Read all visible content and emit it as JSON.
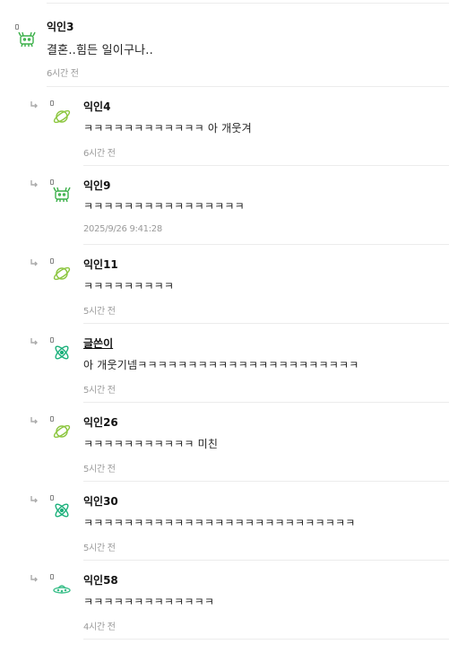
{
  "comments": [
    {
      "nickname": "익인3",
      "text": "결혼..힘든 일이구나..",
      "time": "6시간 전",
      "avatar_icon": "crab-icon",
      "is_reply": false
    },
    {
      "nickname": "익인4",
      "text": "ㅋㅋㅋㅋㅋㅋㅋㅋㅋㅋㅋㅋ 아 개웃겨",
      "time": "6시간 전",
      "avatar_icon": "planet-icon",
      "is_reply": true
    },
    {
      "nickname": "익인9",
      "text": "ㅋㅋㅋㅋㅋㅋㅋㅋㅋㅋㅋㅋㅋㅋㅋㅋ",
      "time": "2025/9/26 9:41:28",
      "avatar_icon": "crab-icon",
      "is_reply": true
    },
    {
      "nickname": "익인11",
      "text": "ㅋㅋㅋㅋㅋㅋㅋㅋㅋ",
      "time": "5시간 전",
      "avatar_icon": "planet-icon",
      "is_reply": true
    },
    {
      "nickname": "글쓴이",
      "text": "아 개웃기넴ㅋㅋㅋㅋㅋㅋㅋㅋㅋㅋㅋㅋㅋㅋㅋㅋㅋㅋㅋㅋㅋㅋ",
      "time": "5시간 전",
      "avatar_icon": "atom-icon",
      "is_reply": true,
      "is_author": true
    },
    {
      "nickname": "익인26",
      "text": "ㅋㅋㅋㅋㅋㅋㅋㅋㅋㅋㅋ 미친",
      "time": "5시간 전",
      "avatar_icon": "planet-icon",
      "is_reply": true
    },
    {
      "nickname": "익인30",
      "text": "ㅋㅋㅋㅋㅋㅋㅋㅋㅋㅋㅋㅋㅋㅋㅋㅋㅋㅋㅋㅋㅋㅋㅋㅋㅋㅋㅋ",
      "time": "5시간 전",
      "avatar_icon": "atom-icon",
      "is_reply": true
    },
    {
      "nickname": "익인58",
      "text": "ㅋㅋㅋㅋㅋㅋㅋㅋㅋㅋㅋㅋㅋ",
      "time": "4시간 전",
      "avatar_icon": "ufo-icon",
      "is_reply": true
    }
  ],
  "colors": {
    "crab": "#3cb04a",
    "planet": "#8cc63f",
    "atom": "#1ab07a",
    "ufo": "#3bbf8a",
    "time": "#9a9a9a"
  }
}
